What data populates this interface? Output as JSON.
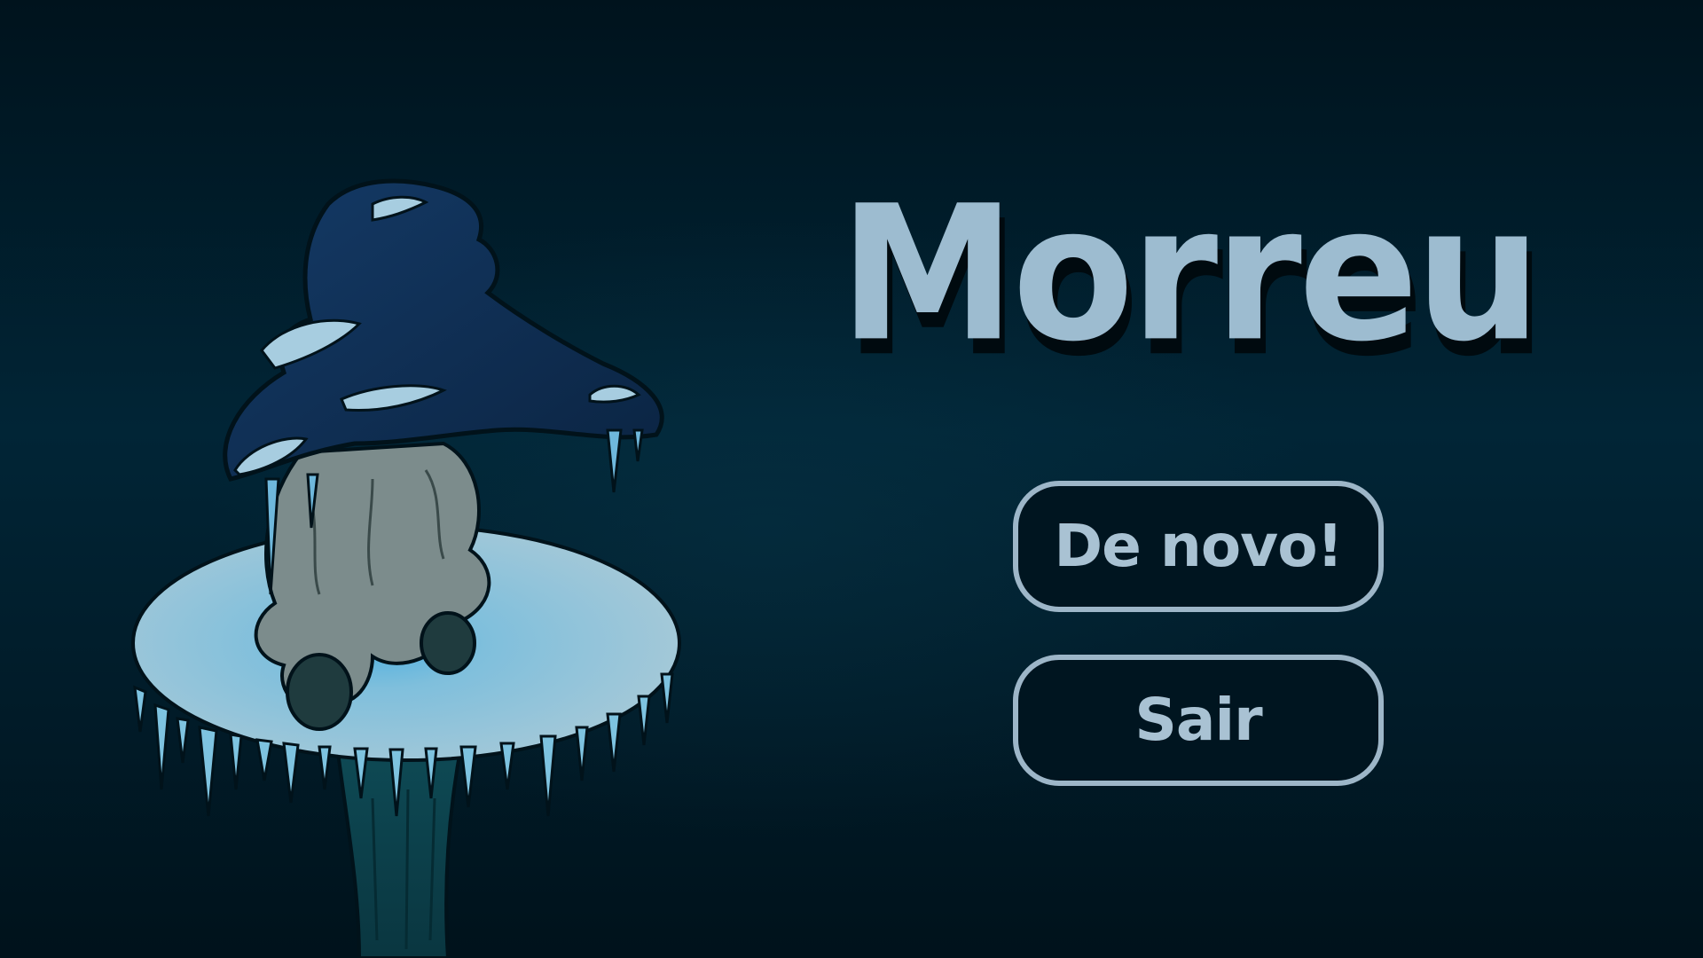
{
  "game_over": {
    "title": "Morreu",
    "buttons": {
      "retry_label": "De novo!",
      "quit_label": "Sair"
    }
  },
  "colors": {
    "background": "#01202e",
    "title": "#9dbcd0",
    "button_border": "#9db6c8",
    "button_text": "#a9c2d3",
    "button_bg": "#001520",
    "mushroom_cap": "#0e2e52",
    "ice_table": "#98c6d8"
  },
  "icons": {
    "character": "frozen-mushroom-character-icon",
    "platform": "ice-mushroom-platform-icon"
  }
}
